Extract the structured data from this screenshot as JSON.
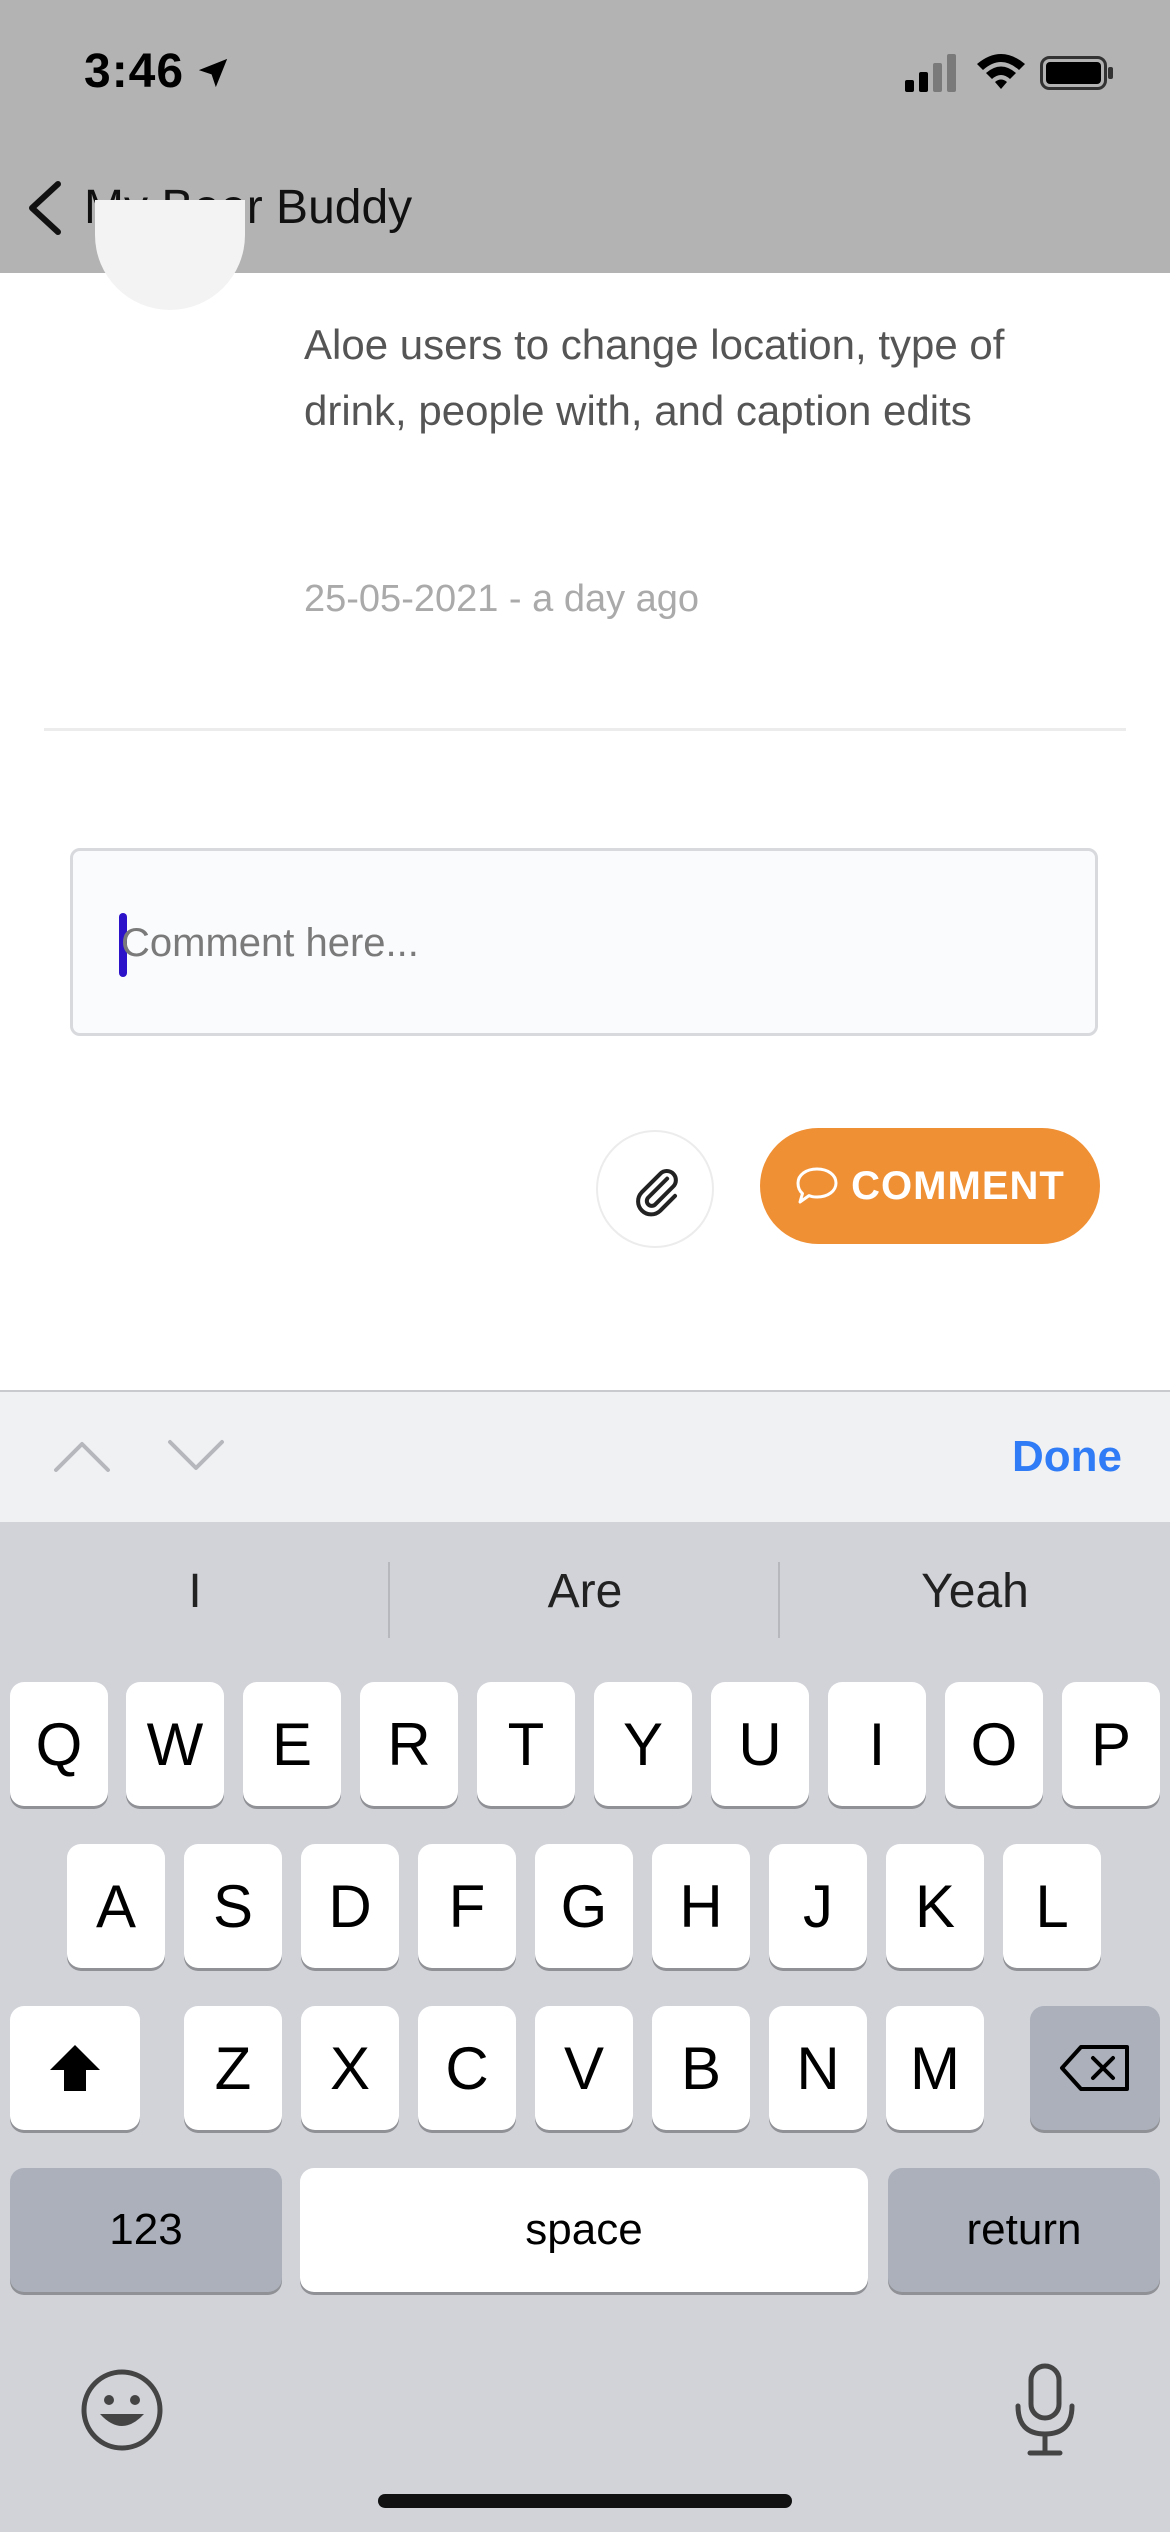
{
  "status_bar": {
    "time": "3:46"
  },
  "header": {
    "title": "My Beer Buddy"
  },
  "post": {
    "text": "Aloe users to change location, type of drink, people with, and caption edits",
    "date": "25-05-2021 - a day ago"
  },
  "comment": {
    "placeholder": "Comment here...",
    "submit_label": "COMMENT"
  },
  "accessory": {
    "done_label": "Done"
  },
  "keyboard": {
    "suggestions": [
      "I",
      "Are",
      "Yeah"
    ],
    "row1": [
      "Q",
      "W",
      "E",
      "R",
      "T",
      "Y",
      "U",
      "I",
      "O",
      "P"
    ],
    "row2": [
      "A",
      "S",
      "D",
      "F",
      "G",
      "H",
      "J",
      "K",
      "L"
    ],
    "row3": [
      "Z",
      "X",
      "C",
      "V",
      "B",
      "N",
      "M"
    ],
    "numbers_label": "123",
    "space_label": "space",
    "return_label": "return"
  },
  "colors": {
    "header_bg": "#b3b3b3",
    "accent": "#f09035",
    "done": "#2f7cf6",
    "caret": "#2c12c9"
  }
}
